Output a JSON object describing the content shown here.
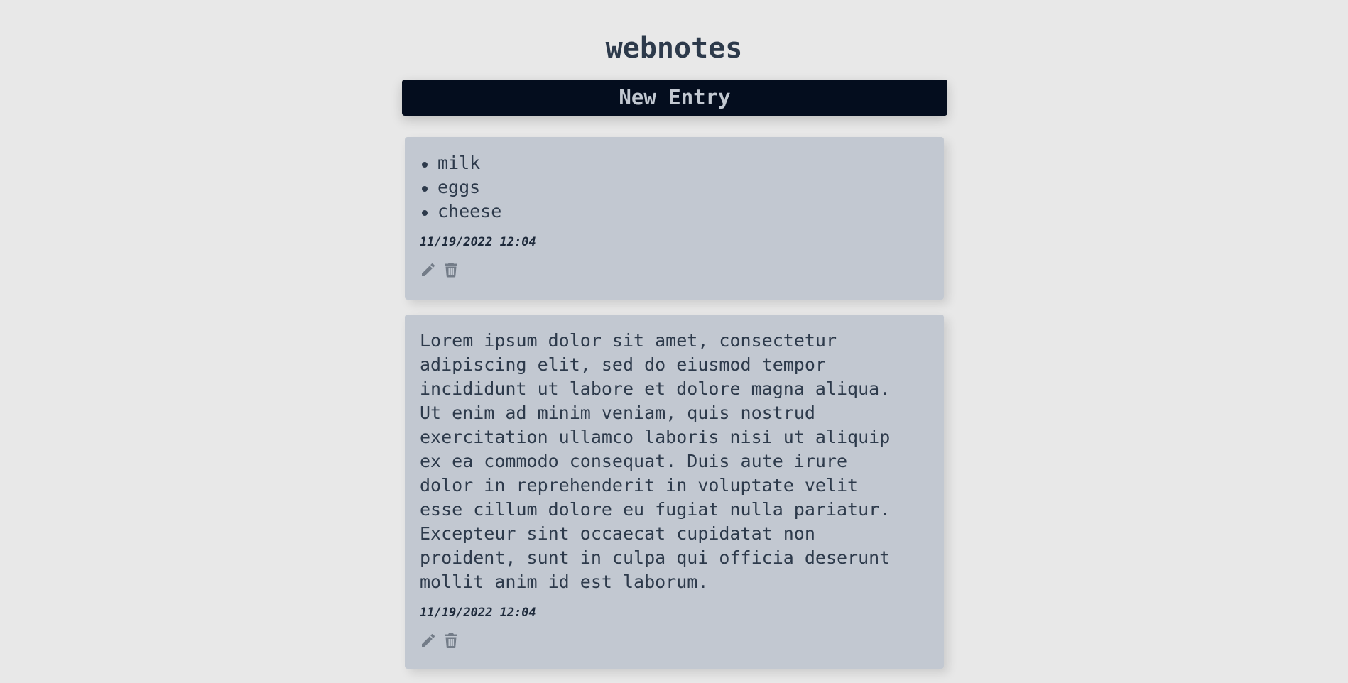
{
  "app": {
    "title": "webnotes",
    "new_entry_label": "New Entry"
  },
  "notes": [
    {
      "type": "list",
      "items": [
        "milk",
        "eggs",
        "cheese"
      ],
      "date": "11/19/2022 12:04",
      "actions": [
        "pencil-icon",
        "trash-icon"
      ]
    },
    {
      "type": "text",
      "text": "Lorem ipsum dolor sit amet, consectetur\nadipiscing elit, sed do eiusmod tempor\nincididunt ut labore et dolore magna aliqua.\nUt enim ad minim veniam, quis nostrud\nexercitation ullamco laboris nisi ut aliquip\nex ea commodo consequat. Duis aute irure\ndolor in reprehenderit in voluptate velit\nesse cillum dolore eu fugiat nulla pariatur.\nExcepteur sint occaecat cupidatat non\nproident, sunt in culpa qui officia deserunt\nmollit anim id est laborum.",
      "date": "11/19/2022 12:04",
      "actions": [
        "pencil-icon",
        "trash-icon"
      ]
    }
  ],
  "colors": {
    "background": "#e8e8e8",
    "button": "#040d1e",
    "card": "#c2c8d1",
    "text": "#2d3a4b",
    "icon": "#737c88"
  }
}
